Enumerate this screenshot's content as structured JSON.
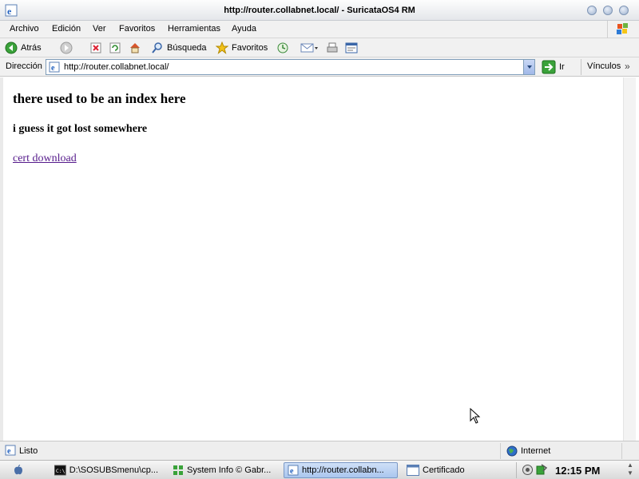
{
  "window": {
    "title": "http://router.collabnet.local/ - SuricataOS4 RM"
  },
  "menubar": {
    "items": [
      "Archivo",
      "Edición",
      "Ver",
      "Favoritos",
      "Herramientas",
      "Ayuda"
    ]
  },
  "toolbar": {
    "back_label": "Atrás",
    "search_label": "Búsqueda",
    "favorites_label": "Favoritos"
  },
  "addressbar": {
    "label": "Dirección",
    "url": "http://router.collabnet.local/",
    "go_label": "Ir",
    "links_label": "Vínculos"
  },
  "page": {
    "heading": "there used to be an index here",
    "subheading": "i guess it got lost somewhere",
    "link_text": "cert download"
  },
  "statusbar": {
    "status": "Listo",
    "zone": "Internet"
  },
  "taskbar": {
    "tasks": [
      {
        "label": "D:\\SOSUBSmenu\\cp...",
        "icon": "console-icon",
        "active": false
      },
      {
        "label": "System Info  © Gabr...",
        "icon": "system-info-icon",
        "active": false
      },
      {
        "label": "http://router.collabn...",
        "icon": "ie-icon",
        "active": true
      },
      {
        "label": "Certificado",
        "icon": "window-icon",
        "active": false
      }
    ],
    "clock": "12:15 PM"
  },
  "colors": {
    "visited_link": "#551a8b",
    "active_task": "#aac6ee"
  }
}
